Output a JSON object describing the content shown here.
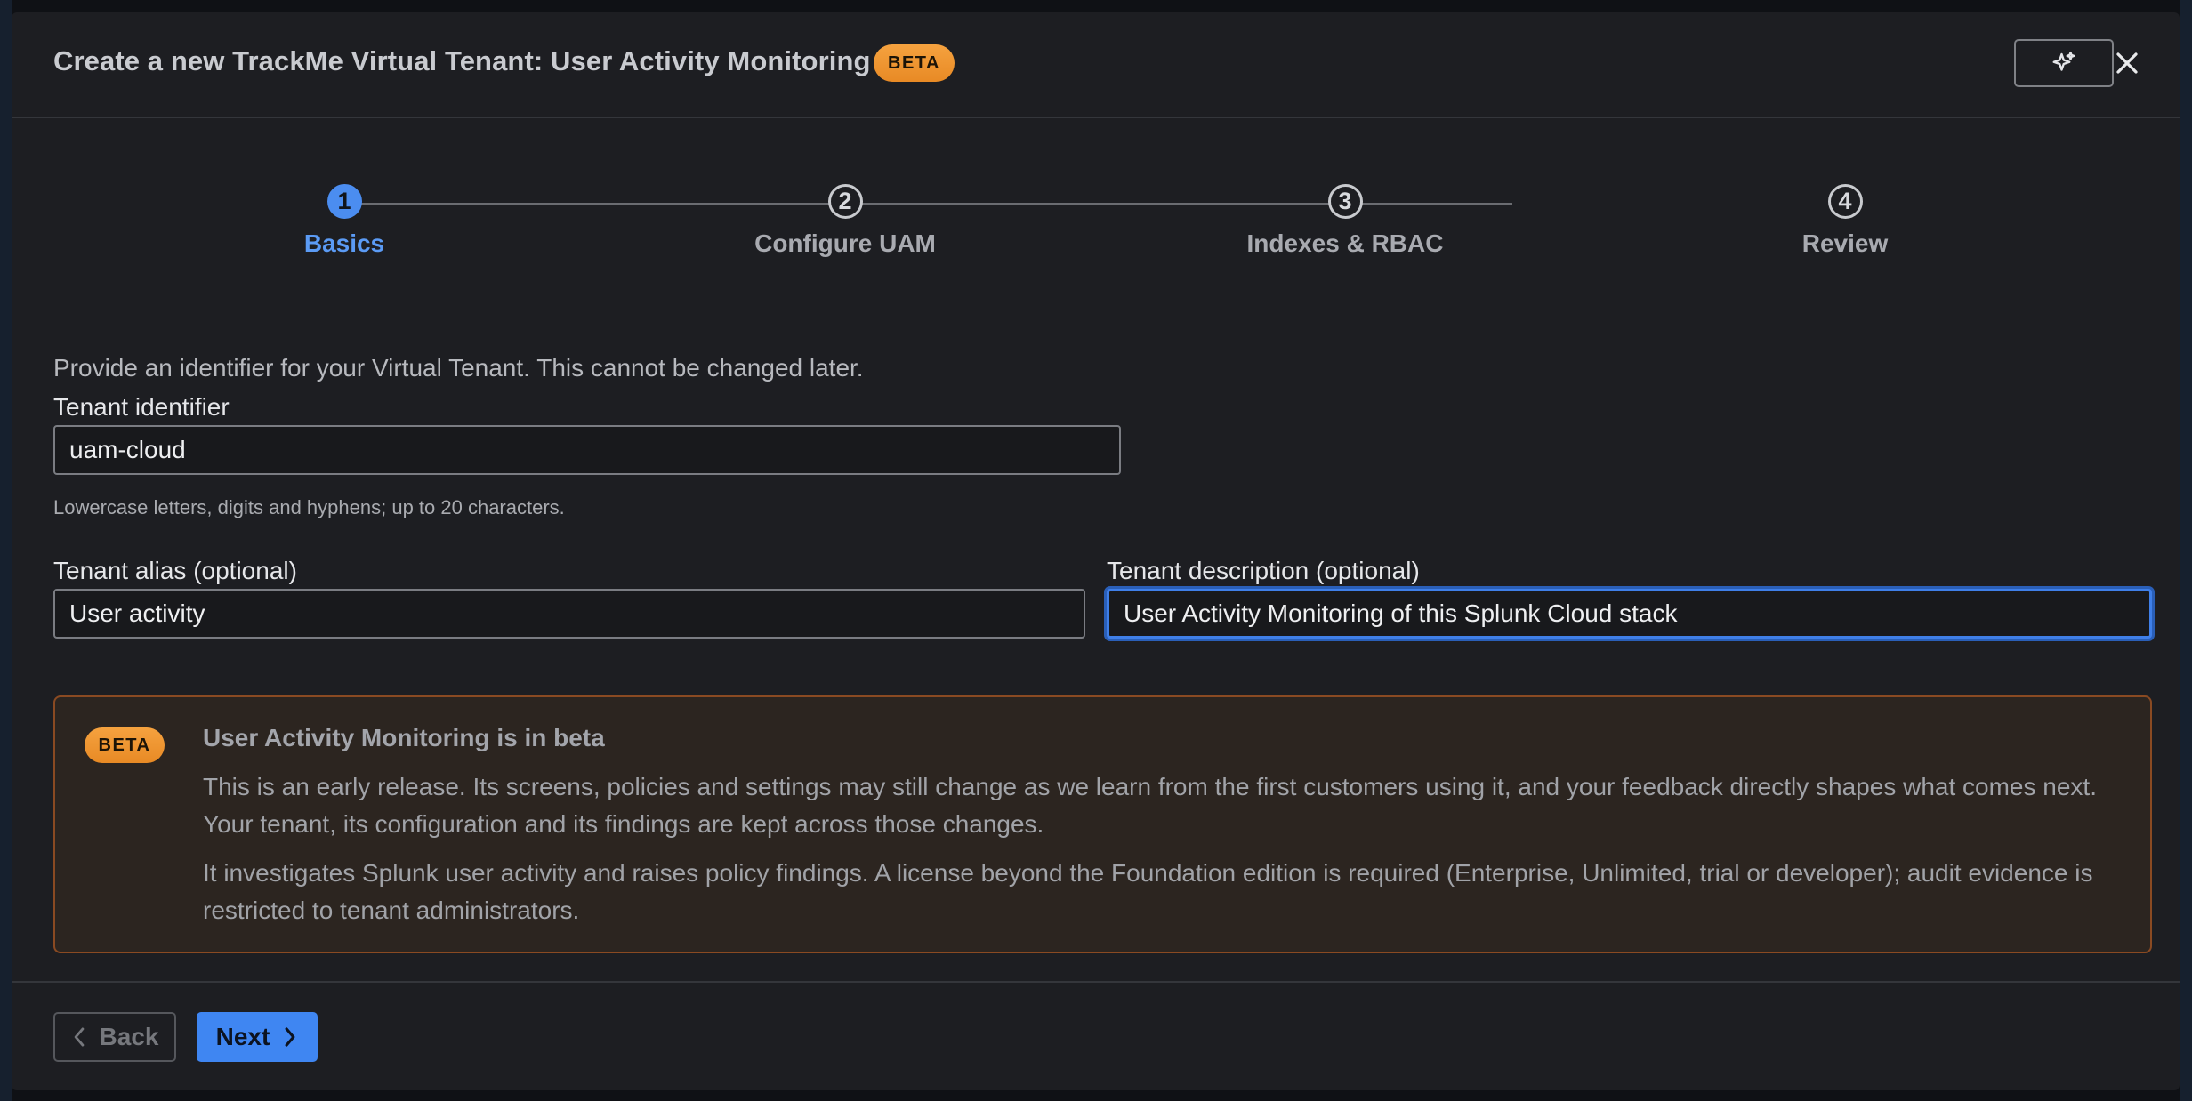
{
  "dialog": {
    "title": "Create a new TrackMe Virtual Tenant: User Activity Monitoring",
    "badge": "BETA"
  },
  "colors": {
    "accent": "#4b8df0",
    "beta_badge": "#f19a32",
    "beta_box_border": "#8a4a22",
    "dialog_bg": "#1d1e22"
  },
  "icons": {
    "ai_assist": "sparkle-icon",
    "close": "close-icon",
    "back": "chevron-left-icon",
    "next": "chevron-right-icon"
  },
  "stepper": {
    "steps": [
      {
        "number": "1",
        "label": "Basics",
        "state": "active"
      },
      {
        "number": "2",
        "label": "Configure UAM",
        "state": "inactive"
      },
      {
        "number": "3",
        "label": "Indexes & RBAC",
        "state": "inactive"
      },
      {
        "number": "4",
        "label": "Review",
        "state": "inactive"
      }
    ]
  },
  "form": {
    "instruction": "Provide an identifier for your Virtual Tenant. This cannot be changed later.",
    "tenant_identifier": {
      "label": "Tenant identifier",
      "value": "uam-cloud",
      "help": "Lowercase letters, digits and hyphens; up to 20 characters."
    },
    "tenant_alias": {
      "label": "Tenant alias (optional)",
      "value": "User activity"
    },
    "tenant_description": {
      "label": "Tenant description (optional)",
      "value": "User Activity Monitoring of this Splunk Cloud stack",
      "focused": true
    }
  },
  "beta_notice": {
    "badge": "BETA",
    "title": "User Activity Monitoring is in beta",
    "paragraph1": "This is an early release. Its screens, policies and settings may still change as we learn from the first customers using it, and your feedback directly shapes what comes next. Your tenant, its configuration and its findings are kept across those changes.",
    "paragraph2": "It investigates Splunk user activity and raises policy findings. A license beyond the Foundation edition is required (Enterprise, Unlimited, trial or developer); audit evidence is restricted to tenant administrators."
  },
  "footer": {
    "back_label": "Back",
    "back_disabled": true,
    "next_label": "Next"
  }
}
